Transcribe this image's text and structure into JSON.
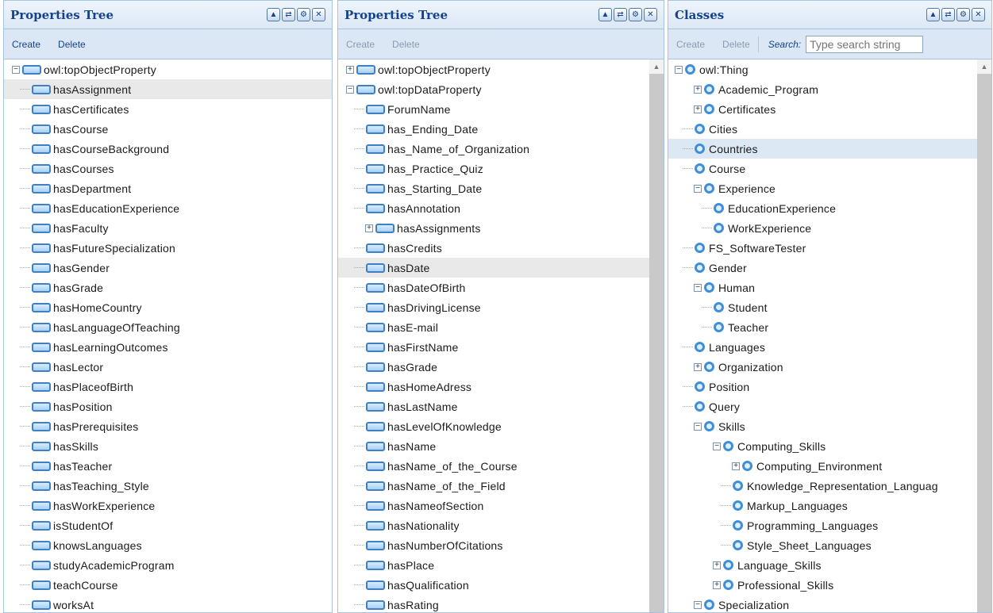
{
  "panels": [
    {
      "id": "p1",
      "title": "Properties Tree",
      "toolbar": [
        "Create",
        "Delete"
      ],
      "toolbar_disabled": false,
      "items": [
        {
          "label": "owl:topObjectProperty",
          "level": 0,
          "expander": "−"
        },
        {
          "label": "hasAssignment",
          "level": 1,
          "selected": true
        },
        {
          "label": "hasCertificates",
          "level": 1
        },
        {
          "label": "hasCourse",
          "level": 1
        },
        {
          "label": "hasCourseBackground",
          "level": 1
        },
        {
          "label": "hasCourses",
          "level": 1
        },
        {
          "label": "hasDepartment",
          "level": 1
        },
        {
          "label": "hasEducationExperience",
          "level": 1
        },
        {
          "label": "hasFaculty",
          "level": 1
        },
        {
          "label": "hasFutureSpecialization",
          "level": 1
        },
        {
          "label": "hasGender",
          "level": 1
        },
        {
          "label": "hasGrade",
          "level": 1
        },
        {
          "label": "hasHomeCountry",
          "level": 1
        },
        {
          "label": "hasLanguageOfTeaching",
          "level": 1
        },
        {
          "label": "hasLearningOutcomes",
          "level": 1
        },
        {
          "label": "hasLector",
          "level": 1
        },
        {
          "label": "hasPlaceofBirth",
          "level": 1
        },
        {
          "label": "hasPosition",
          "level": 1
        },
        {
          "label": "hasPrerequisites",
          "level": 1
        },
        {
          "label": "hasSkills",
          "level": 1
        },
        {
          "label": "hasTeacher",
          "level": 1
        },
        {
          "label": "hasTeaching_Style",
          "level": 1
        },
        {
          "label": "hasWorkExperience",
          "level": 1
        },
        {
          "label": "isStudentOf",
          "level": 1
        },
        {
          "label": "knowsLanguages",
          "level": 1
        },
        {
          "label": "studyAcademicProgram",
          "level": 1
        },
        {
          "label": "teachCourse",
          "level": 1
        },
        {
          "label": "worksAt",
          "level": 1
        }
      ]
    },
    {
      "id": "p2",
      "title": "Properties Tree",
      "toolbar": [
        "Create",
        "Delete"
      ],
      "toolbar_disabled": true,
      "scrollbar": true,
      "items": [
        {
          "label": "owl:topObjectProperty",
          "level": 0,
          "expander": "+"
        },
        {
          "label": "owl:topDataProperty",
          "level": 0,
          "expander": "−"
        },
        {
          "label": "ForumName",
          "level": 1
        },
        {
          "label": "has_Ending_Date",
          "level": 1
        },
        {
          "label": "has_Name_of_Organization",
          "level": 1
        },
        {
          "label": "has_Practice_Quiz",
          "level": 1
        },
        {
          "label": "has_Starting_Date",
          "level": 1
        },
        {
          "label": "hasAnnotation",
          "level": 1
        },
        {
          "label": "hasAssignments",
          "level": 1,
          "expander": "+"
        },
        {
          "label": "hasCredits",
          "level": 1
        },
        {
          "label": "hasDate",
          "level": 1,
          "selected": true
        },
        {
          "label": "hasDateOfBirth",
          "level": 1
        },
        {
          "label": "hasDrivingLicense",
          "level": 1
        },
        {
          "label": "hasE-mail",
          "level": 1
        },
        {
          "label": "hasFirstName",
          "level": 1
        },
        {
          "label": "hasGrade",
          "level": 1
        },
        {
          "label": "hasHomeAdress",
          "level": 1
        },
        {
          "label": "hasLastName",
          "level": 1
        },
        {
          "label": "hasLevelOfKnowledge",
          "level": 1
        },
        {
          "label": "hasName",
          "level": 1
        },
        {
          "label": "hasName_of_the_Course",
          "level": 1
        },
        {
          "label": "hasName_of_the_Field",
          "level": 1
        },
        {
          "label": "hasNameofSection",
          "level": 1
        },
        {
          "label": "hasNationality",
          "level": 1
        },
        {
          "label": "hasNumberOfCitations",
          "level": 1
        },
        {
          "label": "hasPlace",
          "level": 1
        },
        {
          "label": "hasQualification",
          "level": 1
        },
        {
          "label": "hasRating",
          "level": 1
        }
      ]
    },
    {
      "id": "p3",
      "title": "Classes",
      "toolbar": [
        "Create",
        "Delete"
      ],
      "toolbar_disabled": true,
      "scrollbar": true,
      "search": {
        "label": "Search:",
        "placeholder": "Type search string"
      },
      "items": [
        {
          "label": "owl:Thing",
          "level": 0,
          "expander": "−"
        },
        {
          "label": "Academic_Program",
          "level": 1,
          "expander": "+"
        },
        {
          "label": "Certificates",
          "level": 1,
          "expander": "+"
        },
        {
          "label": "Cities",
          "level": 1
        },
        {
          "label": "Countries",
          "level": 1,
          "selected": true
        },
        {
          "label": "Course",
          "level": 1
        },
        {
          "label": "Experience",
          "level": 1,
          "expander": "−"
        },
        {
          "label": "EducationExperience",
          "level": 2
        },
        {
          "label": "WorkExperience",
          "level": 2
        },
        {
          "label": "FS_SoftwareTester",
          "level": 1
        },
        {
          "label": "Gender",
          "level": 1
        },
        {
          "label": "Human",
          "level": 1,
          "expander": "−"
        },
        {
          "label": "Student",
          "level": 2
        },
        {
          "label": "Teacher",
          "level": 2
        },
        {
          "label": "Languages",
          "level": 1
        },
        {
          "label": "Organization",
          "level": 1,
          "expander": "+"
        },
        {
          "label": "Position",
          "level": 1
        },
        {
          "label": "Query",
          "level": 1
        },
        {
          "label": "Skills",
          "level": 1,
          "expander": "−"
        },
        {
          "label": "Computing_Skills",
          "level": 2,
          "expander": "−"
        },
        {
          "label": "Computing_Environment",
          "level": 3,
          "expander": "+"
        },
        {
          "label": "Knowledge_Representation_Languag",
          "level": 3
        },
        {
          "label": "Markup_Languages",
          "level": 3
        },
        {
          "label": "Programming_Languages",
          "level": 3
        },
        {
          "label": "Style_Sheet_Languages",
          "level": 3
        },
        {
          "label": "Language_Skills",
          "level": 2,
          "expander": "+"
        },
        {
          "label": "Professional_Skills",
          "level": 2,
          "expander": "+"
        },
        {
          "label": "Specialization",
          "level": 1,
          "expander": "−"
        }
      ]
    }
  ],
  "header_buttons": [
    {
      "name": "collapse-icon",
      "glyph": "▲"
    },
    {
      "name": "refresh-icon",
      "glyph": "⇄"
    },
    {
      "name": "settings-icon",
      "glyph": "⚙"
    },
    {
      "name": "close-icon",
      "glyph": "✕"
    }
  ]
}
